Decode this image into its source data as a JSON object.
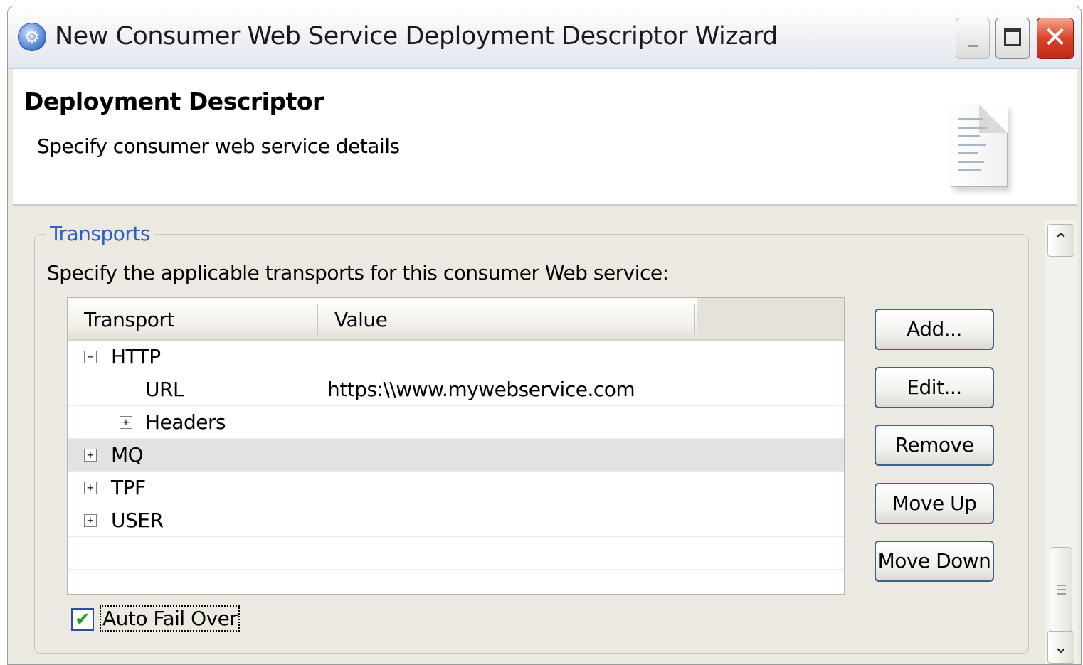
{
  "window": {
    "title": "New Consumer Web Service Deployment Descriptor Wizard",
    "title_icon": "gear-globe-icon",
    "controls": {
      "minimize_icon": "minimize-icon",
      "maximize_icon": "maximize-icon",
      "close_icon": "close-icon",
      "close_glyph": "✕"
    }
  },
  "header": {
    "title": "Deployment Descriptor",
    "description": "Specify consumer web service details",
    "icon": "document-icon"
  },
  "transports_group": {
    "label": "Transports",
    "description": "Specify the applicable transports for this consumer Web service:",
    "table": {
      "columns": [
        "Transport",
        "Value"
      ],
      "rows": [
        {
          "toggle": "⊟",
          "label": "HTTP",
          "value": ""
        },
        {
          "toggle": "",
          "label": "URL",
          "value": "https:\\\\www.mywebservice.com"
        },
        {
          "toggle": "⊞",
          "label": "Headers",
          "value": ""
        },
        {
          "toggle": "⊞",
          "label": "MQ",
          "value": ""
        },
        {
          "toggle": "⊞",
          "label": "TPF",
          "value": ""
        },
        {
          "toggle": "⊞",
          "label": "USER",
          "value": ""
        }
      ],
      "selected_row": "MQ"
    },
    "buttons": {
      "add": "Add...",
      "edit": "Edit...",
      "remove": "Remove",
      "move_up": "Move Up",
      "move_down": "Move Down"
    },
    "auto_fail_over": {
      "label": "Auto Fail Over",
      "checked": true,
      "check_glyph": "✔"
    }
  },
  "scrollbar": {
    "up_glyph": "⌃",
    "down_glyph": "⌄"
  },
  "colors": {
    "accent": "#2e5ec7",
    "close_button": "#d8432a",
    "check": "#21a121"
  }
}
